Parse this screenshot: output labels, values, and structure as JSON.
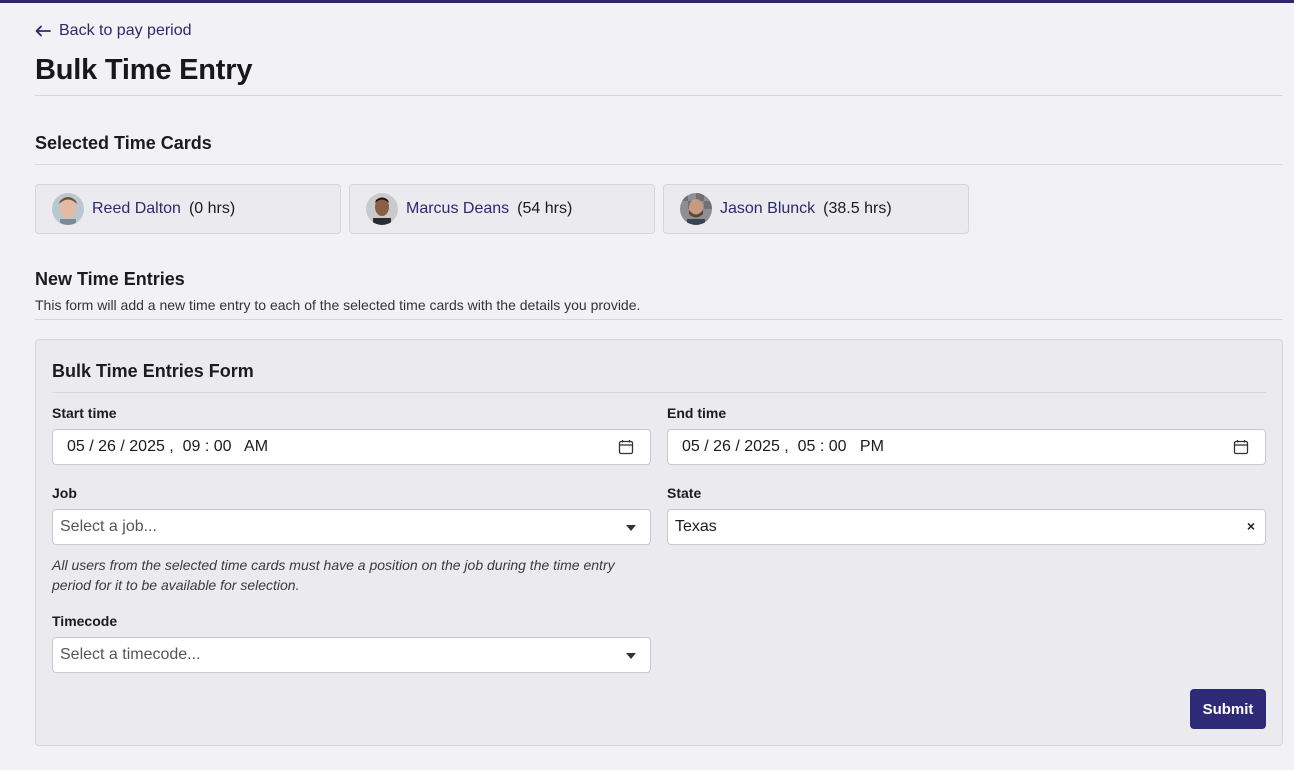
{
  "header": {
    "back_link": "Back to pay period",
    "title": "Bulk Time Entry"
  },
  "selected": {
    "title": "Selected Time Cards",
    "cards": [
      {
        "name": "Reed Dalton",
        "hours": "(0 hrs)"
      },
      {
        "name": "Marcus Deans",
        "hours": "(54 hrs)"
      },
      {
        "name": "Jason Blunck",
        "hours": "(38.5 hrs)"
      }
    ]
  },
  "new_entries": {
    "title": "New Time Entries",
    "description": "This form will add a new time entry to each of the selected time cards with the details you provide."
  },
  "form": {
    "title": "Bulk Time Entries Form",
    "start_time": {
      "label": "Start time",
      "value": "05 / 26 / 2025 ,  09 : 00   AM"
    },
    "end_time": {
      "label": "End time",
      "value": "05 / 26 / 2025 ,  05 : 00   PM"
    },
    "job": {
      "label": "Job",
      "placeholder": "Select a job..."
    },
    "state": {
      "label": "State",
      "value": "Texas",
      "clear": "×"
    },
    "help": "All users from the selected time cards must have a position on the job during the time entry period for it to be available for selection.",
    "timecode": {
      "label": "Timecode",
      "placeholder": "Select a timecode..."
    },
    "submit_label": "Submit"
  },
  "colors": {
    "accent": "#2f2a78",
    "link": "#2b2a6e",
    "background": "#f2f1f5"
  }
}
